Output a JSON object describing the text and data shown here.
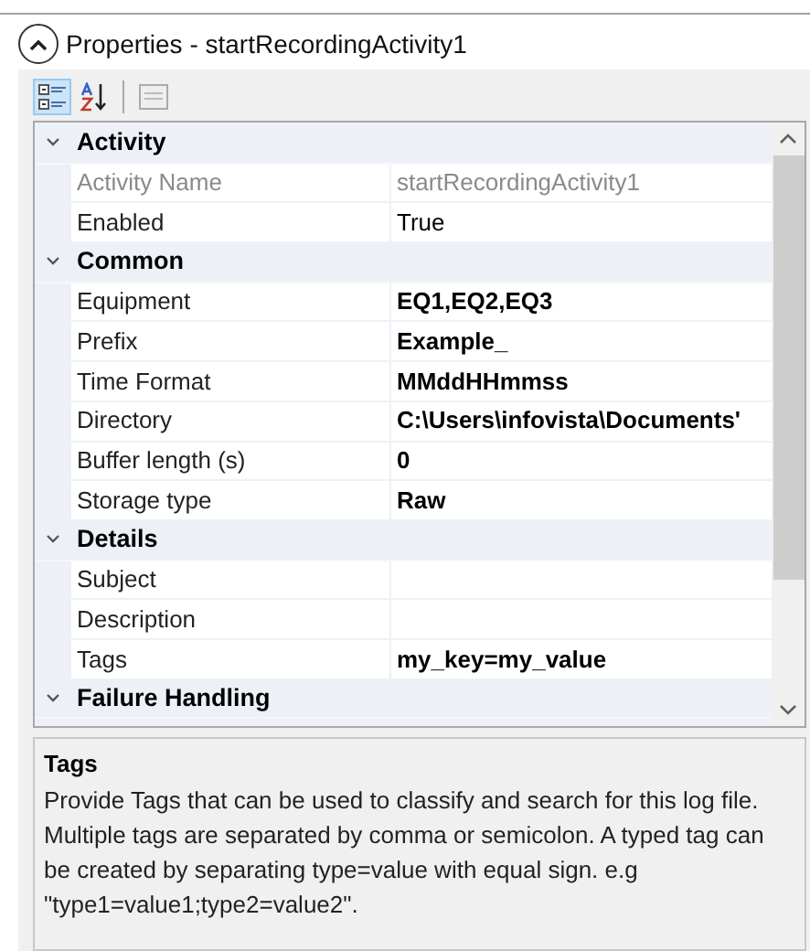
{
  "panel": {
    "title": "Properties - startRecordingActivity1",
    "expanded": true
  },
  "toolbar": [
    {
      "kind": "categorized",
      "selected": true
    },
    {
      "kind": "alphabetical",
      "selected": false
    },
    {
      "kind": "separator"
    },
    {
      "kind": "pages",
      "selected": false,
      "disabled": true
    }
  ],
  "grid": {
    "categories": [
      {
        "name": "Activity",
        "expanded": true,
        "properties": [
          {
            "name": "Activity Name",
            "value": "startRecordingActivity1",
            "readonly": true
          },
          {
            "name": "Enabled",
            "value": "True",
            "readonly": false
          }
        ]
      },
      {
        "name": "Common",
        "expanded": true,
        "properties": [
          {
            "name": "Equipment",
            "value": "EQ1,EQ2,EQ3",
            "readonly": false,
            "modified": true
          },
          {
            "name": "Prefix",
            "value": "Example_",
            "readonly": false,
            "modified": true
          },
          {
            "name": "Time Format",
            "value": "MMddHHmmss",
            "readonly": false,
            "modified": true
          },
          {
            "name": "Directory",
            "value": "C:\\Users\\infovista\\Documents'",
            "readonly": false,
            "modified": true
          },
          {
            "name": "Buffer length (s)",
            "value": "0",
            "readonly": false,
            "modified": true
          },
          {
            "name": "Storage type",
            "value": "Raw",
            "readonly": false,
            "modified": true
          }
        ]
      },
      {
        "name": "Details",
        "expanded": true,
        "properties": [
          {
            "name": "Subject",
            "readonly": false
          },
          {
            "name": "Description",
            "readonly": false
          },
          {
            "name": "Tags",
            "value": "my_key=my_value",
            "readonly": false,
            "modified": true
          }
        ]
      },
      {
        "name": "Failure Handling",
        "expanded": true
      }
    ]
  },
  "description": {
    "title": "Tags",
    "text": "Provide Tags that can be used to classify and search for this log file. Multiple tags are separated by comma or semicolon. A typed tag can be created by separating type=value with equal sign. e.g \"type1=value1;type2=value2\"."
  }
}
